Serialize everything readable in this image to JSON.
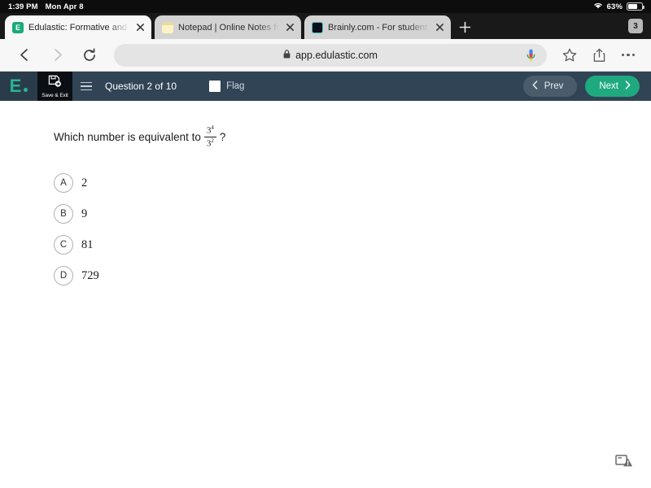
{
  "status_bar": {
    "time": "1:39 PM",
    "date": "Mon Apr 8",
    "battery_percent": "63%",
    "wifi_icon": "wifi-icon",
    "battery_icon": "battery-icon"
  },
  "browser": {
    "tabs": [
      {
        "title": "Edulastic: Formative and Su",
        "favicon": "edulastic-favicon",
        "favicon_letter": "E",
        "active": true,
        "close_icon": "close-icon"
      },
      {
        "title": "Notepad | Online Notes free",
        "favicon": "notepad-favicon",
        "favicon_letter": "",
        "active": false,
        "close_icon": "close-icon"
      },
      {
        "title": "Brainly.com - For students.",
        "favicon": "brainly-favicon",
        "favicon_letter": "",
        "active": false,
        "close_icon": "close-icon"
      }
    ],
    "new_tab_label": "+",
    "tab_count": "3",
    "toolbar": {
      "back_icon": "back-arrow-icon",
      "forward_icon": "forward-arrow-icon",
      "reload_icon": "reload-icon",
      "lock_icon": "lock-icon",
      "url": "app.edulastic.com",
      "mic_icon": "microphone-icon",
      "bookmark_icon": "star-icon",
      "share_icon": "share-icon",
      "menu_icon": "more-options-icon"
    }
  },
  "app_header": {
    "logo_letter": "E",
    "save_exit_label": "Save & Exit",
    "save_icon": "save-exit-icon",
    "menu_icon": "hamburger-menu-icon",
    "question_counter": "Question 2 of 10",
    "flag_label": "Flag",
    "flag_checked": false,
    "prev_label": "Prev",
    "next_label": "Next",
    "prev_icon": "chevron-left-icon",
    "next_icon": "chevron-right-icon",
    "accent_green": "#1fa97e",
    "header_bg": "#304455"
  },
  "question": {
    "prompt_prefix": "Which number is equivalent to",
    "fraction_numerator_base": "3",
    "fraction_numerator_exponent": "4",
    "fraction_denominator_base": "3",
    "fraction_denominator_exponent": "2",
    "prompt_suffix": "?",
    "choices": [
      {
        "letter": "A",
        "text": "2"
      },
      {
        "letter": "B",
        "text": "9"
      },
      {
        "letter": "C",
        "text": "81"
      },
      {
        "letter": "D",
        "text": "729"
      }
    ]
  },
  "footer": {
    "accessibility_icon": "accessibility-alert-icon"
  }
}
